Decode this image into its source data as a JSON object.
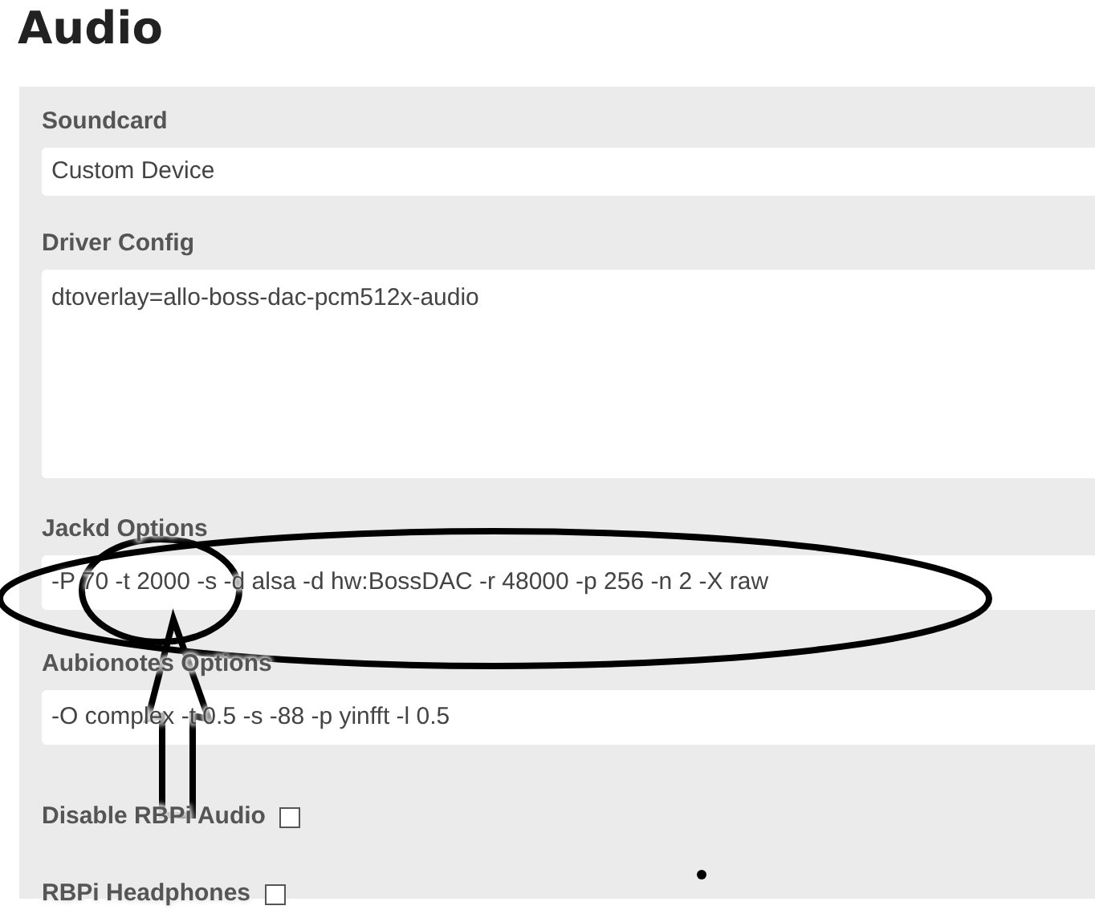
{
  "title": "Audio",
  "fields": [
    {
      "kind": "select",
      "label": "Soundcard",
      "value": "Custom Device"
    },
    {
      "kind": "textarea",
      "label": "Driver Config",
      "value": "dtoverlay=allo-boss-dac-pcm512x-audio"
    },
    {
      "kind": "input",
      "label": "Jackd Options",
      "value": "-P 70 -t 2000 -s -d alsa -d hw:BossDAC -r 48000 -p 256 -n 2 -X raw"
    },
    {
      "kind": "input",
      "label": "Aubionotes Options",
      "value": "-O complex -t 0.5 -s -88  -p yinfft -l 0.5"
    },
    {
      "kind": "checkbox",
      "label": "Disable RBPi Audio",
      "checked": false
    },
    {
      "kind": "checkbox",
      "label": "RBPi Headphones",
      "checked": false
    }
  ]
}
